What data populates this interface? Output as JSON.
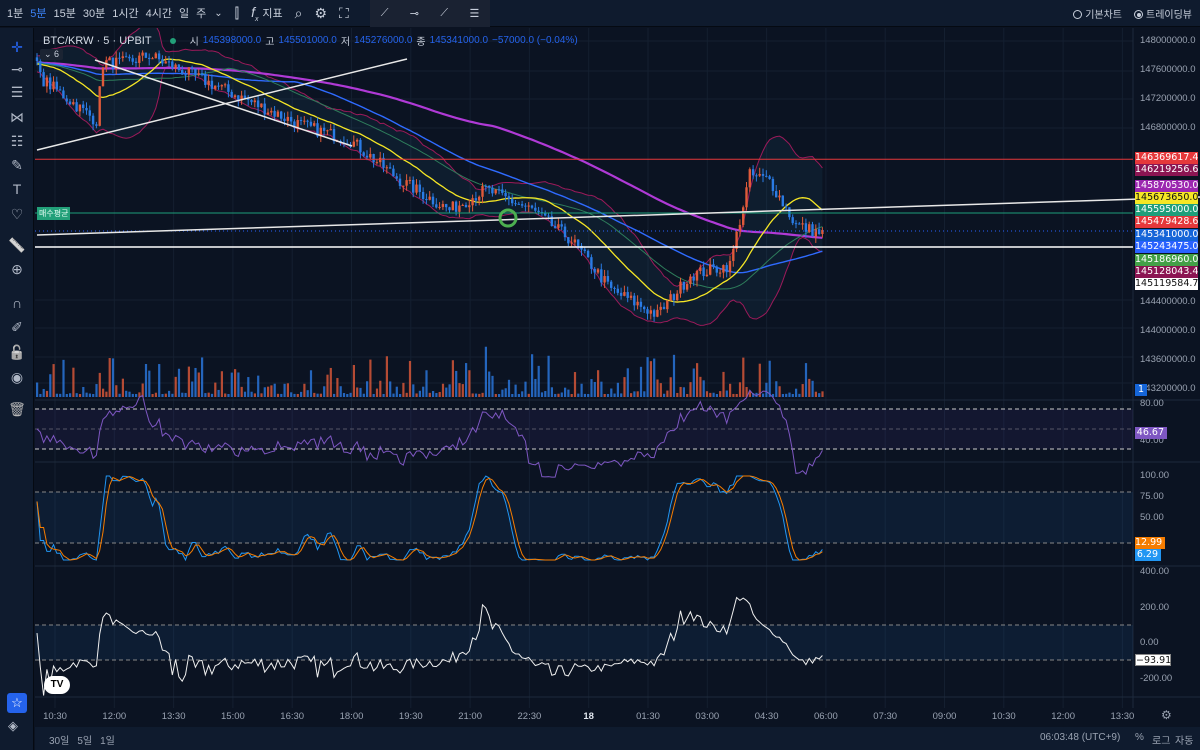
{
  "toolbar": {
    "timeframes": [
      "1분",
      "5분",
      "15분",
      "30분",
      "1시간",
      "4시간",
      "일",
      "주"
    ],
    "active_timeframe": "5분",
    "indicators_label": "지표",
    "chart_modes": [
      {
        "label": "기본차트",
        "selected": false
      },
      {
        "label": "트레이딩뷰",
        "selected": true
      }
    ]
  },
  "left_tools": [
    "crosshair-icon",
    "horizontal-line-icon",
    "fib-lines-icon",
    "pattern-icon",
    "parallel-lines-icon",
    "brush-icon",
    "text-icon",
    "heart-icon",
    "ruler-icon",
    "zoom-in-icon",
    "magnet-icon",
    "lock-drawing-icon",
    "unlock-icon",
    "eye-icon",
    "trash-icon"
  ],
  "legend": {
    "symbol": "BTC/KRW · 5 · UPBIT",
    "o_label": "시",
    "o": "145398000.0",
    "h_label": "고",
    "h": "145501000.0",
    "l_label": "저",
    "l": "145276000.0",
    "c_label": "종",
    "c": "145341000.0",
    "change": "−57000.0 (−0.04%)",
    "indicator_count": "6"
  },
  "buy_avg_label": "매수평균",
  "price_axis": [
    "148000000.0",
    "147600000.0",
    "147200000.0",
    "146800000.0",
    "144400000.0",
    "144000000.0",
    "143600000.0",
    "143200000.0"
  ],
  "price_labels": [
    {
      "value": "146369617.4",
      "bg": "#e5383b",
      "fg": "#ffffff"
    },
    {
      "value": "146219256.6",
      "bg": "#8b1552",
      "fg": "#ffffff"
    },
    {
      "value": "145870530.0",
      "bg": "#9c27b0",
      "fg": "#ffffff"
    },
    {
      "value": "145673650.0",
      "bg": "#f5e625",
      "fg": "#111111"
    },
    {
      "value": "145595000.0",
      "bg": "#1e9e7a",
      "fg": "#ffffff"
    },
    {
      "value": "145479428.6",
      "bg": "#e5383b",
      "fg": "#ffffff"
    },
    {
      "value": "145341000.0",
      "bg": "#1565d8",
      "fg": "#ffffff"
    },
    {
      "value": "145243475.0",
      "bg": "#2962ff",
      "fg": "#ffffff"
    },
    {
      "value": "145186960.0",
      "bg": "#43a047",
      "fg": "#ffffff"
    },
    {
      "value": "145128043.4",
      "bg": "#8b1552",
      "fg": "#ffffff"
    },
    {
      "value": "145119584.7",
      "bg": "#ffffff",
      "fg": "#111111"
    }
  ],
  "volume_label": "1",
  "rsi": {
    "axis": [
      "80.00",
      "40.00"
    ],
    "value": "46.67"
  },
  "stoch": {
    "axis": [
      "100.00",
      "75.00",
      "50.00"
    ],
    "k": "12.99",
    "d": "6.29"
  },
  "cci": {
    "axis": [
      "400.00",
      "200.00",
      "0.00",
      "-200.00"
    ],
    "value": "−93.91"
  },
  "time_axis": [
    "10:30",
    "12:00",
    "13:30",
    "15:00",
    "16:30",
    "18:00",
    "19:30",
    "21:00",
    "22:30",
    "18",
    "01:30",
    "03:00",
    "04:30",
    "06:00",
    "07:30",
    "09:00",
    "10:30",
    "12:00",
    "13:30"
  ],
  "bottom": {
    "ranges": [
      "30일",
      "5일",
      "1일"
    ],
    "clock": "06:03:48 (UTC+9)",
    "percent": "%",
    "log": "로그",
    "auto": "자동"
  },
  "chart_data": {
    "type": "candlestick",
    "interval": "5m",
    "price_path": [
      [
        0,
        147530000
      ],
      [
        20,
        147700000
      ],
      [
        18,
        146900000
      ],
      [
        27,
        147700000
      ],
      [
        34,
        147800000
      ],
      [
        60,
        147260000
      ],
      [
        80,
        146840000
      ],
      [
        95,
        146630000
      ],
      [
        110,
        146080000
      ],
      [
        125,
        145670000
      ],
      [
        136,
        145950000
      ],
      [
        150,
        145670000
      ],
      [
        162,
        145250000
      ],
      [
        174,
        144570000
      ],
      [
        188,
        144220000
      ],
      [
        198,
        144770000
      ],
      [
        210,
        144910000
      ],
      [
        216,
        146150000
      ],
      [
        222,
        146080000
      ],
      [
        230,
        145460000
      ],
      [
        238,
        145340000
      ]
    ],
    "horizontal_lines": [
      146369617.4,
      145595000.0,
      145119584.7
    ],
    "colors": {
      "up": "#e05a3a",
      "down": "#2a7be4",
      "ma_short": "#f5e625",
      "ma_mid": "#2e7d5b",
      "ma_long": "#2f6bff",
      "ma_200": "#b03ad6",
      "bb": "#9c1a5a"
    }
  }
}
